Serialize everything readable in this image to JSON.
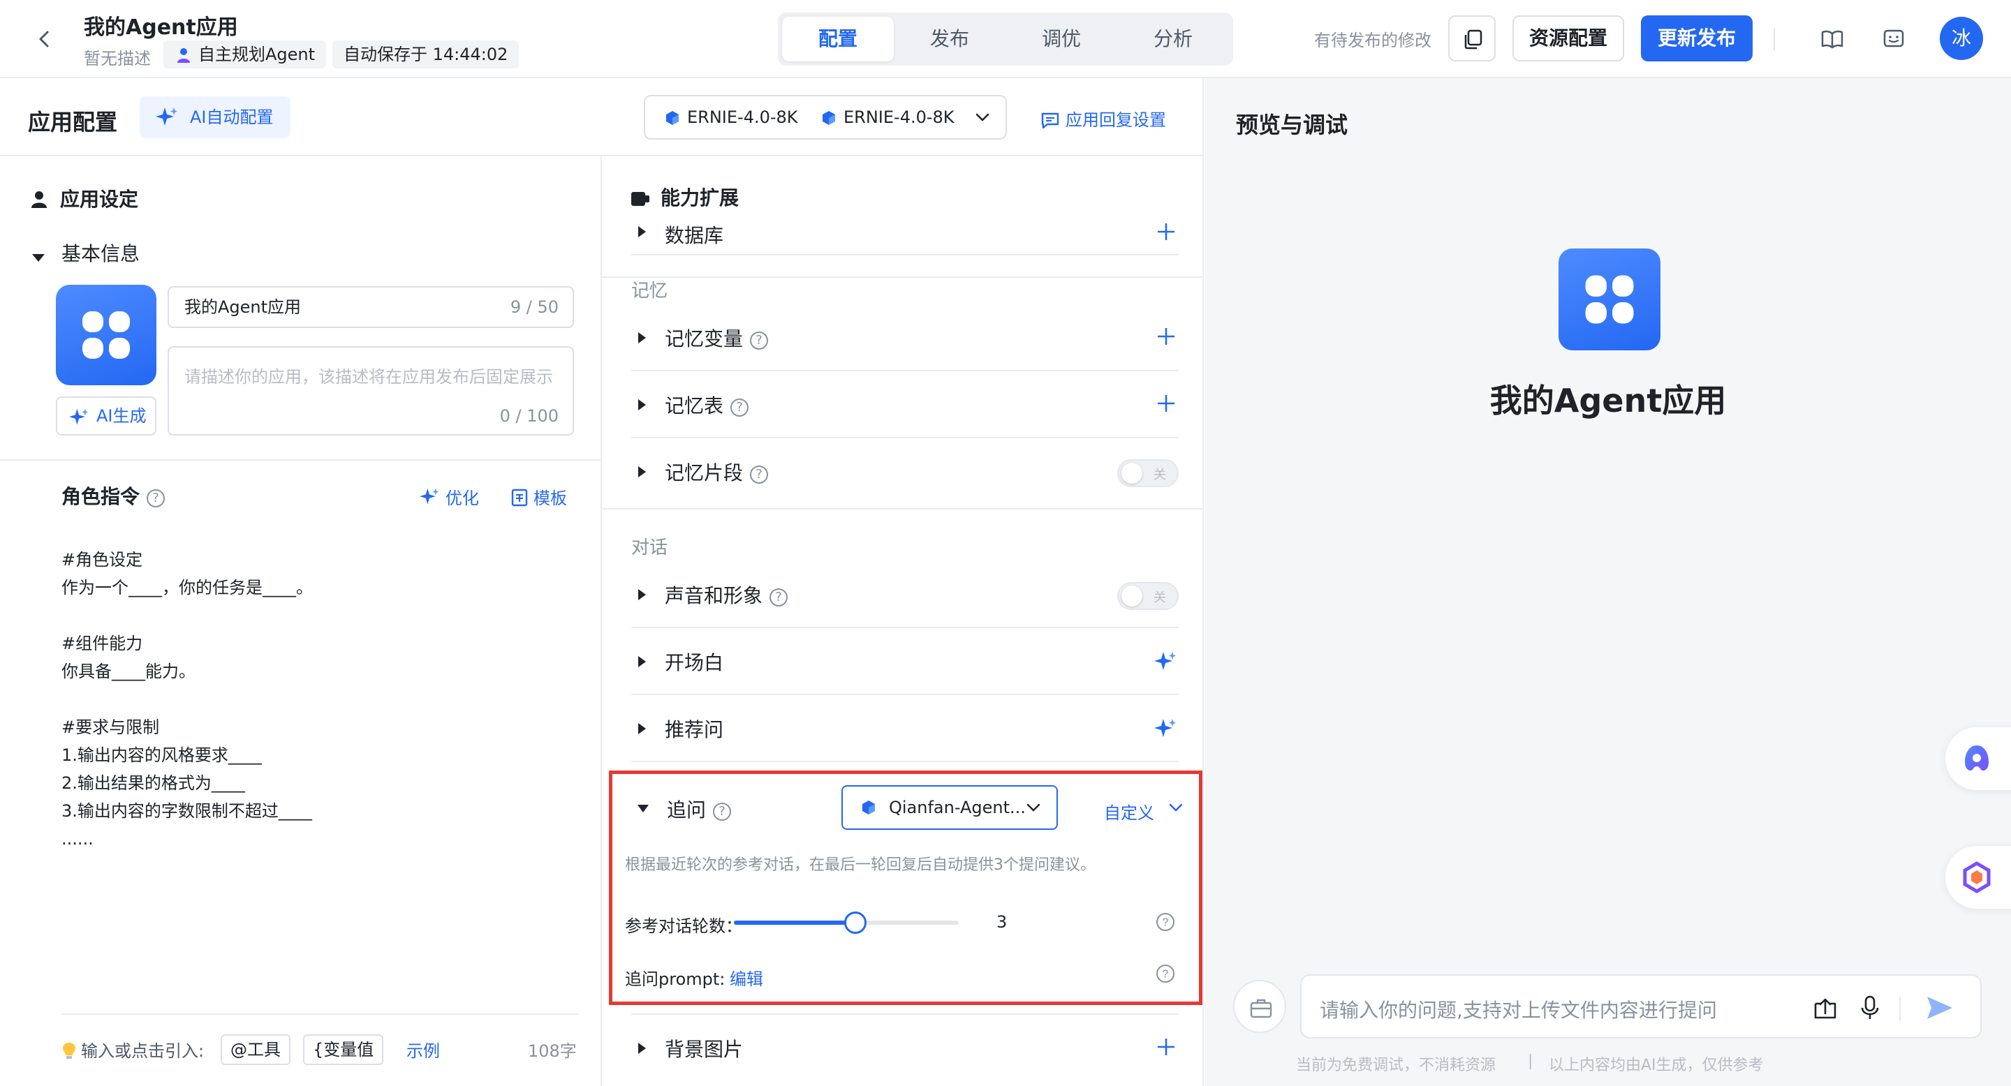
{
  "header": {
    "app_title": "我的Agent应用",
    "app_desc": "暂无描述",
    "agent_tag": "自主规划Agent",
    "autosave": "自动保存于 14:44:02",
    "tabs": [
      {
        "label": "配置",
        "active": true
      },
      {
        "label": "发布",
        "active": false
      },
      {
        "label": "调优",
        "active": false
      },
      {
        "label": "分析",
        "active": false
      }
    ],
    "pending_text": "有待发布的修改",
    "resource_btn": "资源配置",
    "publish_btn": "更新发布",
    "avatar_text": "冰"
  },
  "config_bar": {
    "title": "应用配置",
    "ai_auto_label": "AI自动配置",
    "model_1": "ERNIE-4.0-8K",
    "model_2": "ERNIE-4.0-8K",
    "reply_settings": "应用回复设置"
  },
  "left": {
    "section_title": "应用设定",
    "basic_info": "基本信息",
    "name_value": "我的Agent应用",
    "name_count": "9 / 50",
    "desc_placeholder": "请描述你的应用，该描述将在应用发布后固定展示",
    "desc_count": "0 / 100",
    "ai_gen_label": "AI生成",
    "role_title": "角色指令",
    "optimize_label": "优化",
    "template_label": "模板",
    "prompt_text": "#角色设定\n作为一个____，你的任务是____。\n\n#组件能力\n你具备____能力。\n\n#要求与限制\n1.输出内容的风格要求____\n2.输出结果的格式为____\n3.输出内容的字数限制不超过____\n......",
    "footer_hint": "输入或点击引入:",
    "chip_tool": "@工具",
    "chip_var": "{变量值",
    "example_label": "示例",
    "word_count": "108字"
  },
  "middle": {
    "title": "能力扩展",
    "cut_row": "数据库",
    "memory_group": "记忆",
    "memory_vars": "记忆变量",
    "memory_table": "记忆表",
    "memory_snippet": "记忆片段",
    "toggle_off": "关",
    "dialog_group": "对话",
    "voice_avatar": "声音和形象",
    "opening": "开场白",
    "recommend": "推荐问",
    "followup": {
      "label": "追问",
      "model": "Qianfan-Agent...",
      "custom": "自定义",
      "desc": "根据最近轮次的参考对话，在最后一轮回复后自动提供3个提问建议。",
      "rounds_label": "参考对话轮数：",
      "rounds_value": "3",
      "rounds_fraction": 0.54,
      "prompt_label": "追问prompt:",
      "edit_label": "编辑"
    },
    "background": "背景图片"
  },
  "right": {
    "title": "预览与调试",
    "app_name": "我的Agent应用",
    "input_placeholder": "请输入你的问题,支持对上传文件内容进行提问",
    "disclaimer_1": "当前为免费调试，不消耗资源",
    "disclaimer_sep": "|",
    "disclaimer_2": "以上内容均由AI生成，仅供参考"
  },
  "colors": {
    "accent": "#2468f2",
    "highlight_border": "#e53935"
  }
}
